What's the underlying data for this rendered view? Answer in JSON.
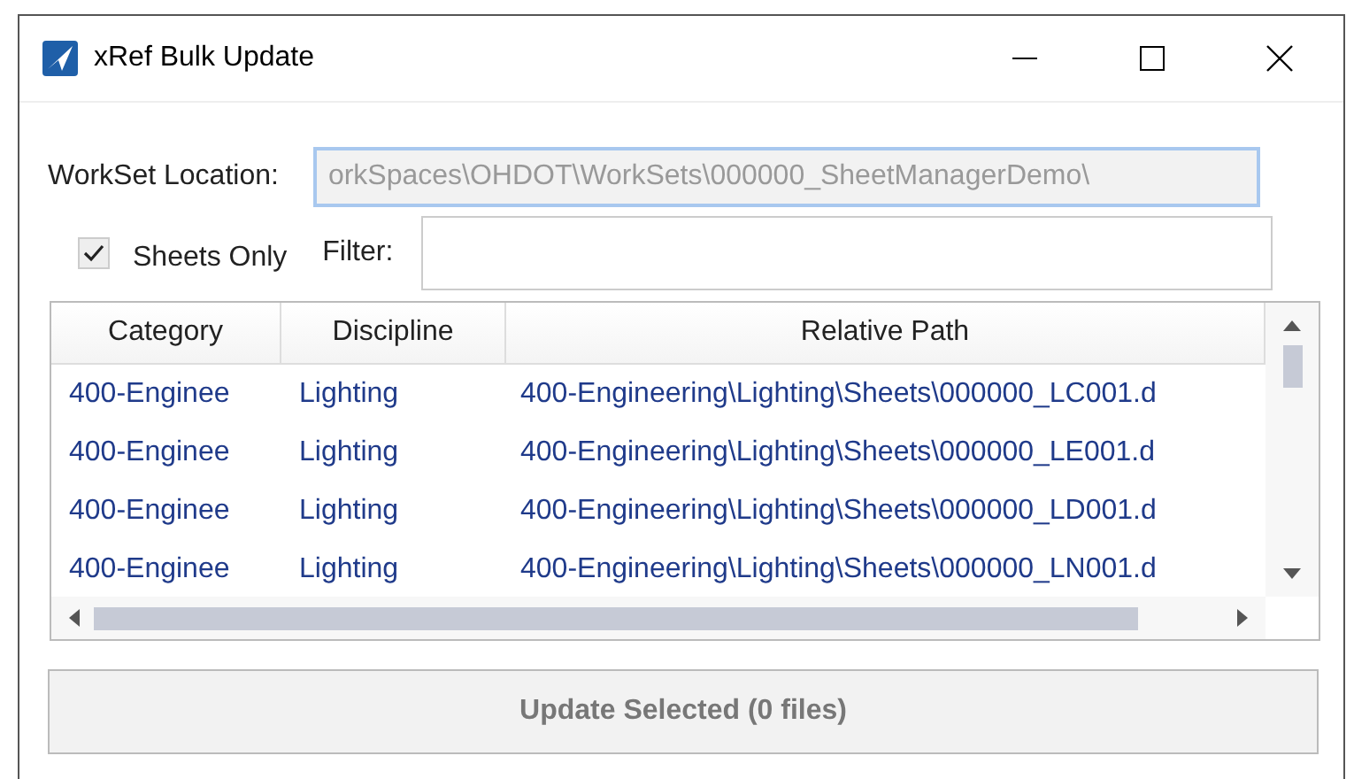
{
  "window": {
    "title": "xRef Bulk Update"
  },
  "workset": {
    "label": "WorkSet Location:",
    "value": "orkSpaces\\OHDOT\\WorkSets\\000000_SheetManagerDemo\\",
    "disabled": true
  },
  "sheets_only": {
    "label": "Sheets Only",
    "checked": true
  },
  "filter": {
    "label": "Filter:"
  },
  "table": {
    "columns": [
      "Category",
      "Discipline",
      "Relative Path"
    ],
    "rows": [
      {
        "cells": [
          "400-Enginee",
          "Lighting",
          "400-Engineering\\Lighting\\Sheets\\000000_LC001.d"
        ]
      },
      {
        "cells": [
          "400-Enginee",
          "Lighting",
          "400-Engineering\\Lighting\\Sheets\\000000_LE001.d"
        ]
      },
      {
        "cells": [
          "400-Enginee",
          "Lighting",
          "400-Engineering\\Lighting\\Sheets\\000000_LD001.d"
        ]
      },
      {
        "cells": [
          "400-Enginee",
          "Lighting",
          "400-Engineering\\Lighting\\Sheets\\000000_LN001.d"
        ]
      }
    ]
  },
  "update_button": {
    "label": "Update Selected (0 files)",
    "disabled": true
  }
}
